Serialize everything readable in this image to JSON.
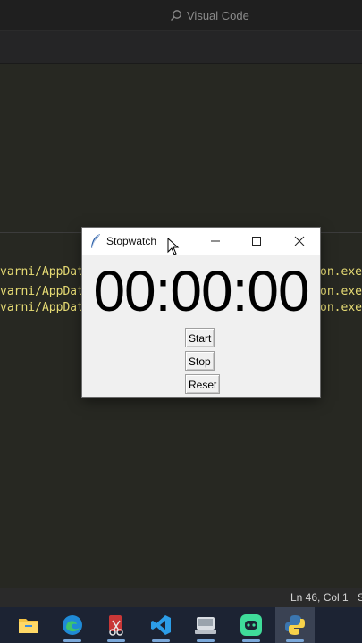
{
  "vscode": {
    "search_label": "Visual Code",
    "status_position": "Ln 46, Col 1",
    "status_extra": "S"
  },
  "terminal": {
    "lines": [
      {
        "left": "varni/AppData",
        "right": "hon.exe"
      },
      {
        "left": "varni/AppData",
        "right": "hon.exe"
      },
      {
        "left": "varni/AppData",
        "right": "hon.exe"
      }
    ]
  },
  "stopwatch": {
    "title": "Stopwatch",
    "time": "00:00:00",
    "start_label": "Start",
    "stop_label": "Stop",
    "reset_label": "Reset"
  },
  "taskbar": {
    "items": [
      {
        "icon": "file-explorer-icon"
      },
      {
        "icon": "edge-icon"
      },
      {
        "icon": "snipping-tool-icon"
      },
      {
        "icon": "vscode-icon"
      },
      {
        "icon": "network-drive-icon"
      },
      {
        "icon": "discord-icon"
      },
      {
        "icon": "python-icon",
        "active": true
      }
    ]
  },
  "colors": {
    "terminal_text": "#e6db74",
    "editor_bg": "#272822",
    "taskbar_bg": "#1c2333"
  }
}
